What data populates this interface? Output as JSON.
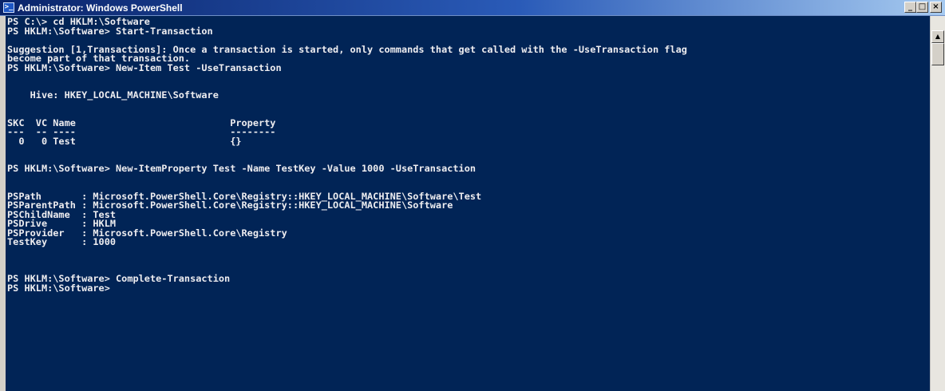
{
  "window": {
    "title": "Administrator: Windows PowerShell",
    "icon_glyph": ">_",
    "minimize_glyph": "_",
    "maximize_glyph": "□",
    "close_glyph": "×"
  },
  "scrollbar": {
    "up_glyph": "▲"
  },
  "console": {
    "lines": [
      "PS C:\\> cd HKLM:\\Software",
      "PS HKLM:\\Software> Start-Transaction",
      "",
      "Suggestion [1,Transactions]: Once a transaction is started, only commands that get called with the -UseTransaction flag",
      "become part of that transaction.",
      "PS HKLM:\\Software> New-Item Test -UseTransaction",
      "",
      "",
      "    Hive: HKEY_LOCAL_MACHINE\\Software",
      "",
      "",
      "SKC  VC Name                           Property",
      "---  -- ----                           --------",
      "  0   0 Test                           {}",
      "",
      "",
      "PS HKLM:\\Software> New-ItemProperty Test -Name TestKey -Value 1000 -UseTransaction",
      "",
      "",
      "PSPath       : Microsoft.PowerShell.Core\\Registry::HKEY_LOCAL_MACHINE\\Software\\Test",
      "PSParentPath : Microsoft.PowerShell.Core\\Registry::HKEY_LOCAL_MACHINE\\Software",
      "PSChildName  : Test",
      "PSDrive      : HKLM",
      "PSProvider   : Microsoft.PowerShell.Core\\Registry",
      "TestKey      : 1000",
      "",
      "",
      "",
      "PS HKLM:\\Software> Complete-Transaction",
      "PS HKLM:\\Software>"
    ]
  }
}
